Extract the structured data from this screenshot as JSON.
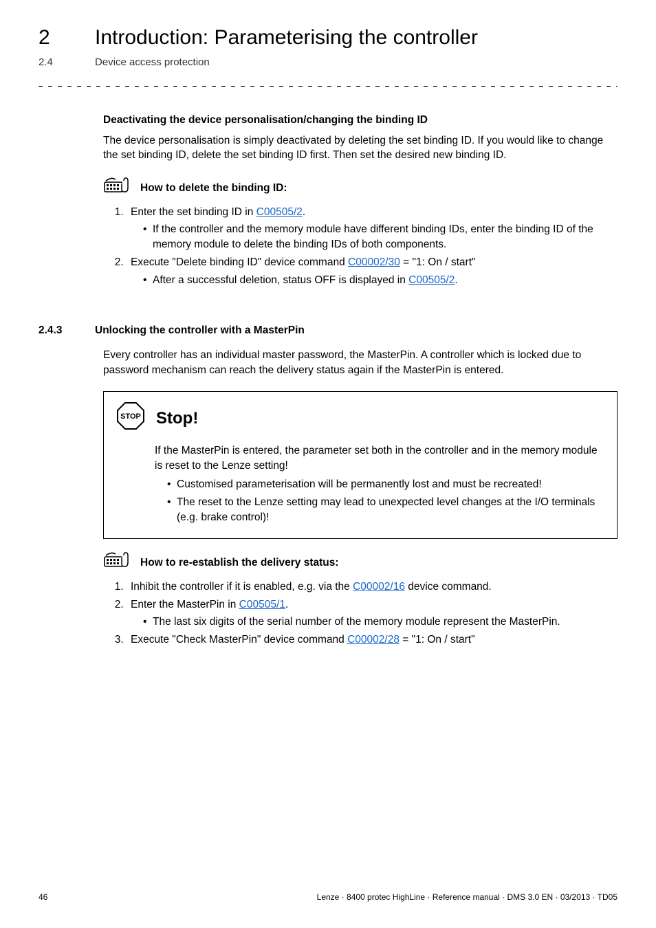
{
  "header": {
    "chapter_num": "2",
    "chapter_title": "Introduction: Parameterising the controller",
    "section_num": "2.4",
    "section_title": "Device access protection"
  },
  "deact": {
    "heading": "Deactivating the device personalisation/changing the binding ID",
    "para": "The device personalisation is simply deactivated by deleting the set binding ID. If you would like to change the set binding ID, delete the set binding ID first. Then set the desired new binding ID.",
    "howto_label": "How to delete the binding ID:",
    "step1_pre": "Enter the set binding ID in ",
    "step1_link": "C00505/2",
    "step1_post": ".",
    "step1_b1": "If the controller and the memory module have different binding IDs, enter the binding ID of the memory module to delete the binding IDs of both components.",
    "step2_pre": "Execute \"Delete binding ID\" device command ",
    "step2_link": "C00002/30",
    "step2_post": "  = \"1: On / start\"",
    "step2_b1_pre": "After a successful deletion, status OFF is displayed in ",
    "step2_b1_link": "C00505/2",
    "step2_b1_post": "."
  },
  "sec243": {
    "num": "2.4.3",
    "title": "Unlocking the controller with a MasterPin",
    "para": "Every controller has an individual master password, the MasterPin. A controller which is locked due to password mechanism can reach the delivery status again if the MasterPin is entered.",
    "stop_title": "Stop!",
    "stop_p": "If the MasterPin is entered, the parameter set both in the controller and in the memory module is reset to the Lenze setting!",
    "stop_b1": "Customised parameterisation will be permanently lost and must be recreated!",
    "stop_b2": "The reset to the Lenze setting may lead to unexpected level changes at the I/O terminals (e.g. brake control)!",
    "howto_label": "How to re-establish the delivery status:",
    "s1_pre": "Inhibit the controller if it is enabled, e.g. via the ",
    "s1_link": "C00002/16",
    "s1_post": " device command.",
    "s2_pre": "Enter the MasterPin in ",
    "s2_link": "C00505/1",
    "s2_post": ".",
    "s2_b1": "The last six digits of the serial number of the memory module represent the MasterPin.",
    "s3_pre": "Execute \"Check MasterPin\" device command ",
    "s3_link": "C00002/28",
    "s3_post": "  = \"1: On / start\""
  },
  "footer": {
    "page": "46",
    "right": "Lenze · 8400 protec HighLine · Reference manual · DMS 3.0 EN · 03/2013 · TD05"
  }
}
